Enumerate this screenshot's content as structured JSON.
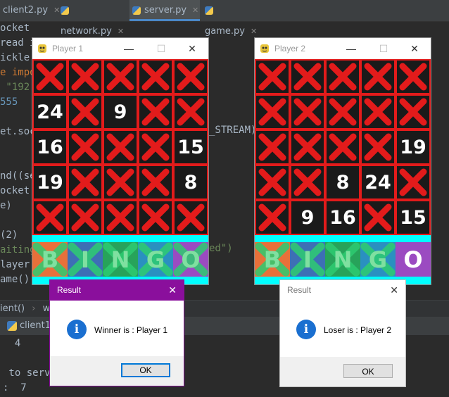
{
  "ide": {
    "tabs": [
      {
        "label": "client2.py",
        "active": false
      },
      {
        "label": "network.py",
        "active": false
      },
      {
        "label": "server.py",
        "active": true
      },
      {
        "label": "game.py",
        "active": false
      }
    ],
    "code_lines": [
      {
        "text": "ocket"
      },
      {
        "text": "read i"
      },
      {
        "text": "ickle"
      },
      {
        "text": "e impo"
      },
      {
        "text": " \"192."
      },
      {
        "text": "555"
      },
      {
        "text": ""
      },
      {
        "text": "et.soc"
      },
      {
        "text": ""
      },
      {
        "text": ""
      },
      {
        "text": "nd((se"
      },
      {
        "text": "ocket."
      },
      {
        "text": "e)"
      },
      {
        "text": ""
      },
      {
        "text": "(2)"
      },
      {
        "text": "aiting"
      },
      {
        "text": "layer"
      },
      {
        "text": "ame()"
      }
    ],
    "code_fragment_stream": "_STREAM)",
    "code_fragment_ed": "ed\")",
    "breadcrumb": [
      "ient()",
      "whil"
    ],
    "run_tab": "client1",
    "console_lines": [
      "  4",
      "",
      " to server",
      ":  7"
    ]
  },
  "windows": [
    {
      "title": "Player 1",
      "cells": [
        "X",
        "X",
        "X",
        "X",
        "X",
        "24",
        "X",
        "9",
        "X",
        "X",
        "16",
        "X",
        "X",
        "X",
        "15",
        "19",
        "X",
        "X",
        "X",
        "8",
        "X",
        "X",
        "X",
        "X",
        "X"
      ],
      "bingo_letters": [
        "B",
        "I",
        "N",
        "G",
        "O"
      ],
      "bingo_struck": [
        true,
        true,
        true,
        true,
        true
      ]
    },
    {
      "title": "Player 2",
      "cells": [
        "X",
        "X",
        "X",
        "X",
        "X",
        "X",
        "X",
        "X",
        "X",
        "X",
        "X",
        "X",
        "X",
        "X",
        "19",
        "X",
        "X",
        "8",
        "24",
        "X",
        "X",
        "9",
        "16",
        "X",
        "15"
      ],
      "bingo_letters": [
        "B",
        "I",
        "N",
        "G",
        "O"
      ],
      "bingo_struck": [
        true,
        true,
        true,
        true,
        false
      ]
    }
  ],
  "dialogs": [
    {
      "title": "Result",
      "message": "Winner is : Player 1",
      "ok": "OK"
    },
    {
      "title": "Result",
      "message": "Loser is : Player 2",
      "ok": "OK"
    }
  ],
  "colors": {
    "dialog1_title_bg": "#8a0f9c",
    "board_border": "#e31b1b",
    "cyan": "#00ffff",
    "tile_colors": [
      "#e8703a",
      "#3d6fb5",
      "#27a35a",
      "#2a90c0",
      "#9b4bc1"
    ]
  }
}
